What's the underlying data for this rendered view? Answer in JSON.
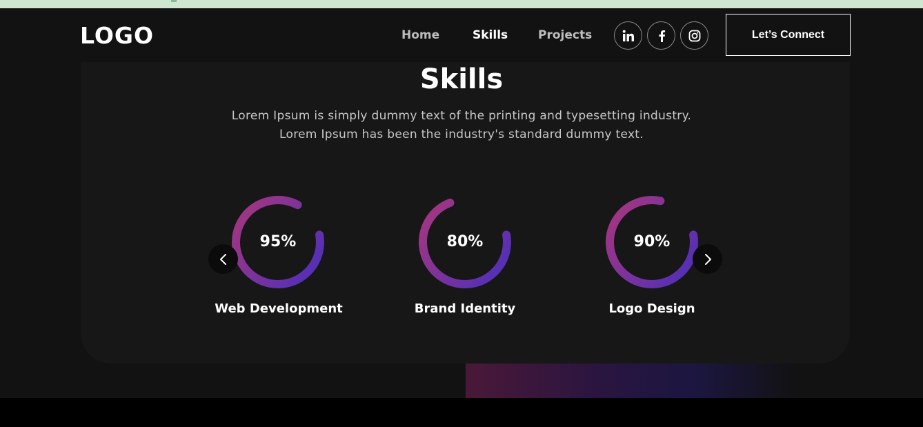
{
  "nav": {
    "logo": "LOGO",
    "links": [
      {
        "label": "Home",
        "active": false
      },
      {
        "label": "Skills",
        "active": true
      },
      {
        "label": "Projects",
        "active": false
      }
    ],
    "social": [
      "linkedin-icon",
      "facebook-icon",
      "instagram-icon"
    ],
    "cta_label": "Let’s Connect"
  },
  "skills": {
    "title": "Skills",
    "description_line1": "Lorem Ipsum is simply dummy text of the printing and typesetting industry.",
    "description_line2": "Lorem Ipsum has been the industry's standard dummy text.",
    "items": [
      {
        "percent_label": "95%",
        "value": 0.95,
        "label": "Web Development"
      },
      {
        "percent_label": "80%",
        "value": 0.8,
        "label": "Brand Identity"
      },
      {
        "percent_label": "90%",
        "value": 0.9,
        "label": "Logo Design"
      }
    ],
    "prev_icon": "chevron-left-icon",
    "next_icon": "chevron-right-icon"
  },
  "colors": {
    "ring_start": "#aa367c",
    "ring_end": "#4a2fbd",
    "background": "#121212",
    "card": "#171717"
  }
}
